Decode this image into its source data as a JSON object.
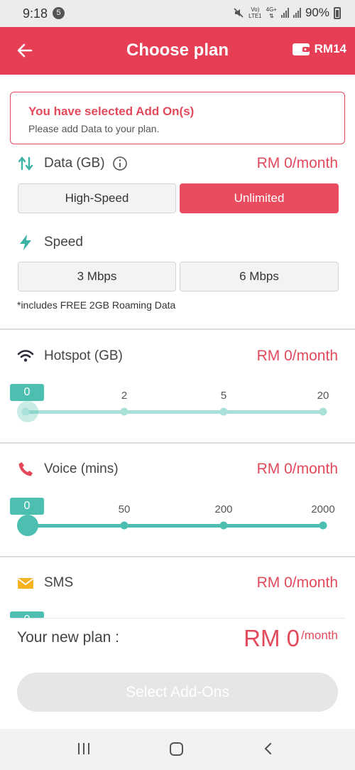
{
  "status_bar": {
    "time": "9:18",
    "notif_count": "5",
    "net_top": "Vo)",
    "net_bottom": "LTE1",
    "net2_top": "4G+",
    "battery": "90%"
  },
  "app_bar": {
    "title": "Choose plan",
    "wallet_amount": "RM14"
  },
  "alert": {
    "title": "You have selected Add On(s)",
    "subtitle": "Please add Data to your plan."
  },
  "data": {
    "label": "Data (GB)",
    "price": "RM 0/month",
    "options": [
      {
        "label": "High-Speed",
        "selected": false
      },
      {
        "label": "Unlimited",
        "selected": true
      }
    ]
  },
  "speed": {
    "label": "Speed",
    "options": [
      {
        "label": "3 Mbps",
        "selected": false
      },
      {
        "label": "6 Mbps",
        "selected": false
      }
    ],
    "note": "*includes FREE 2GB Roaming Data"
  },
  "hotspot": {
    "label": "Hotspot (GB)",
    "price": "RM 0/month",
    "value": "0",
    "ticks": [
      "2",
      "5",
      "20"
    ]
  },
  "voice": {
    "label": "Voice (mins)",
    "price": "RM 0/month",
    "value": "0",
    "ticks": [
      "50",
      "200",
      "2000"
    ]
  },
  "sms": {
    "label": "SMS",
    "price": "RM 0/month",
    "value": "0"
  },
  "summary": {
    "label": "Your new plan :",
    "amount": "RM 0",
    "unit": "/month",
    "button": "Select Add-Ons"
  },
  "colors": {
    "brand": "#e63e54",
    "teal": "#4dbfb0",
    "teal_light": "#a9e0d9",
    "amber": "#f5b324"
  }
}
